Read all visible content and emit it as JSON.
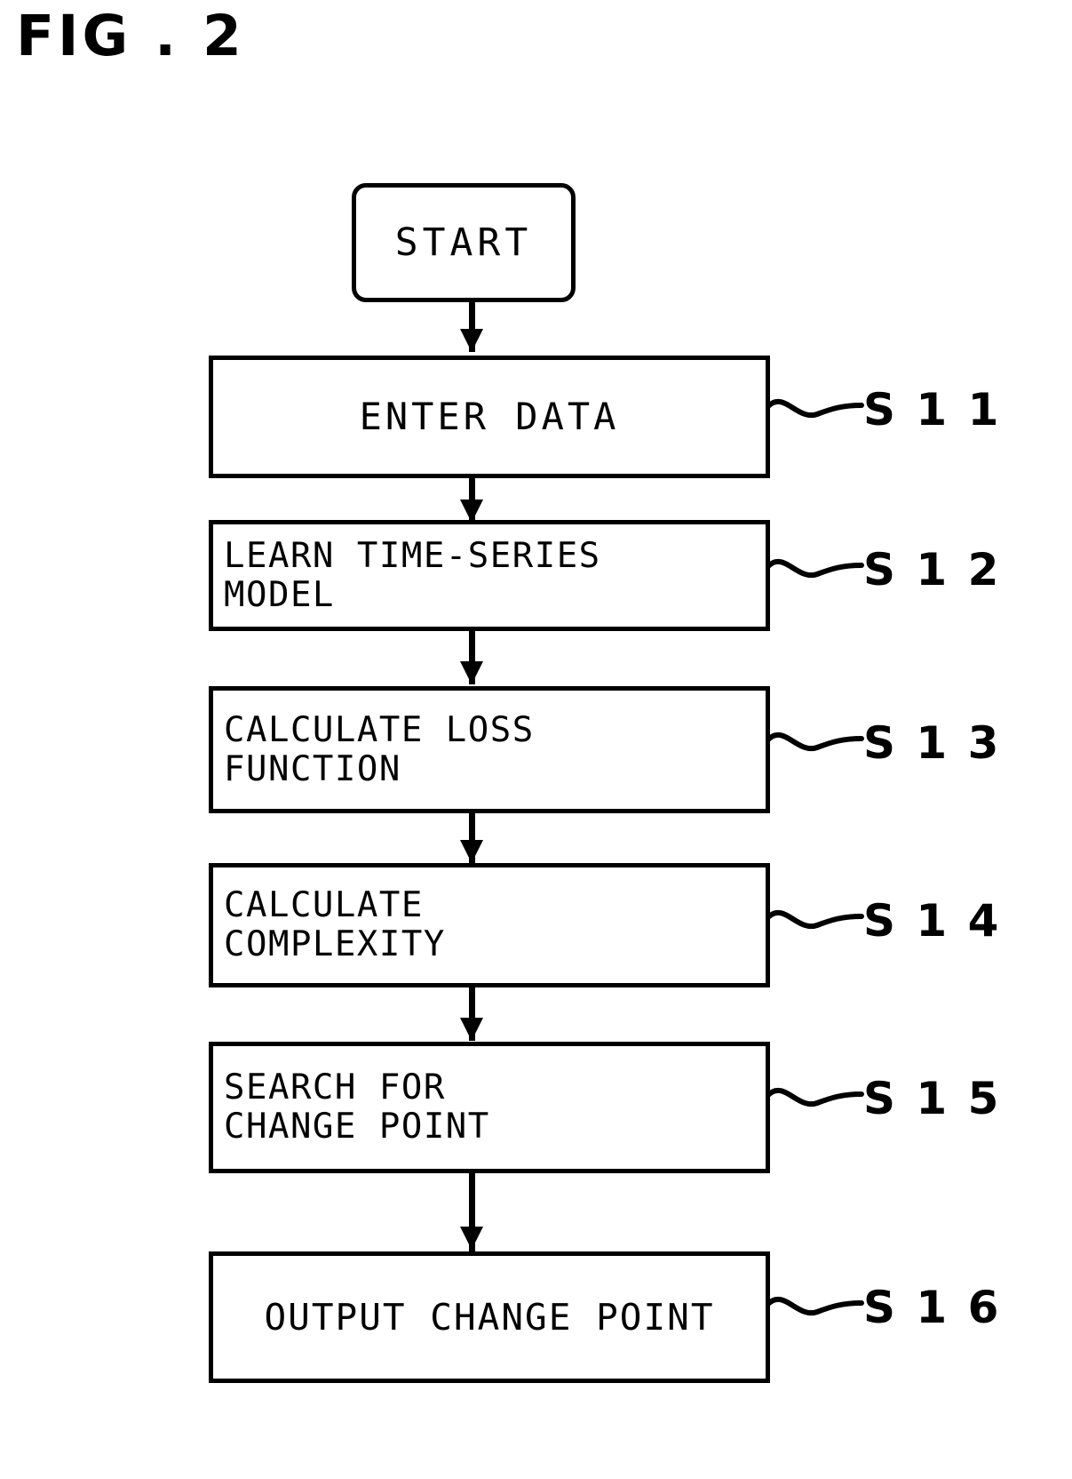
{
  "figure": {
    "title": "FIG . 2",
    "type": "patent-flowchart",
    "ink_color": "#000000",
    "background_color": "#ffffff"
  },
  "flowchart": {
    "start": {
      "label": "START",
      "shape": "rounded-terminal"
    },
    "steps": [
      {
        "id": "s11",
        "text": "ENTER DATA",
        "ref": "S 1 1",
        "align": "center",
        "lines": 1
      },
      {
        "id": "s12",
        "text": "LEARN TIME-SERIES\nMODEL",
        "ref": "S 1 2",
        "align": "left",
        "lines": 2
      },
      {
        "id": "s13",
        "text": "CALCULATE LOSS\nFUNCTION",
        "ref": "S 1 3",
        "align": "left",
        "lines": 2
      },
      {
        "id": "s14",
        "text": "CALCULATE\nCOMPLEXITY",
        "ref": "S 1 4",
        "align": "left",
        "lines": 2
      },
      {
        "id": "s15",
        "text": "SEARCH FOR\nCHANGE POINT",
        "ref": "S 1 5",
        "align": "left",
        "lines": 2
      },
      {
        "id": "s16",
        "text": "OUTPUT CHANGE POINT",
        "ref": "S 1 6",
        "align": "center",
        "lines": 1
      }
    ]
  }
}
